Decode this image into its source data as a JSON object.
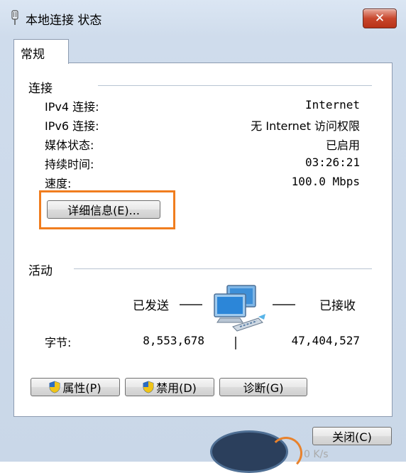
{
  "window": {
    "title": "本地连接 状态",
    "close_label": "✕"
  },
  "tabs": [
    {
      "label": "常规"
    }
  ],
  "connection": {
    "section_label": "连接",
    "rows": [
      {
        "label": "IPv4 连接:",
        "value": "Internet"
      },
      {
        "label": "IPv6 连接:",
        "value": "无 Internet 访问权限"
      },
      {
        "label": "媒体状态:",
        "value": "已启用"
      },
      {
        "label": "持续时间:",
        "value": "03:26:21"
      },
      {
        "label": "速度:",
        "value": "100.0 Mbps"
      }
    ],
    "details_button": "详细信息(E)..."
  },
  "activity": {
    "section_label": "活动",
    "sent_label": "已发送",
    "received_label": "已接收",
    "bytes_label": "字节:",
    "bytes_sent": "8,553,678",
    "bytes_received": "47,404,527"
  },
  "buttons": {
    "properties": "属性(P)",
    "disable": "禁用(D)",
    "diagnose": "诊断(G)",
    "close": "关闭(C)"
  },
  "taskbar_overlay_text": "0 K/s",
  "colors": {
    "highlight": "#f07d1e",
    "close_button": "#c8462c",
    "window_frame": "#cfdcec"
  }
}
